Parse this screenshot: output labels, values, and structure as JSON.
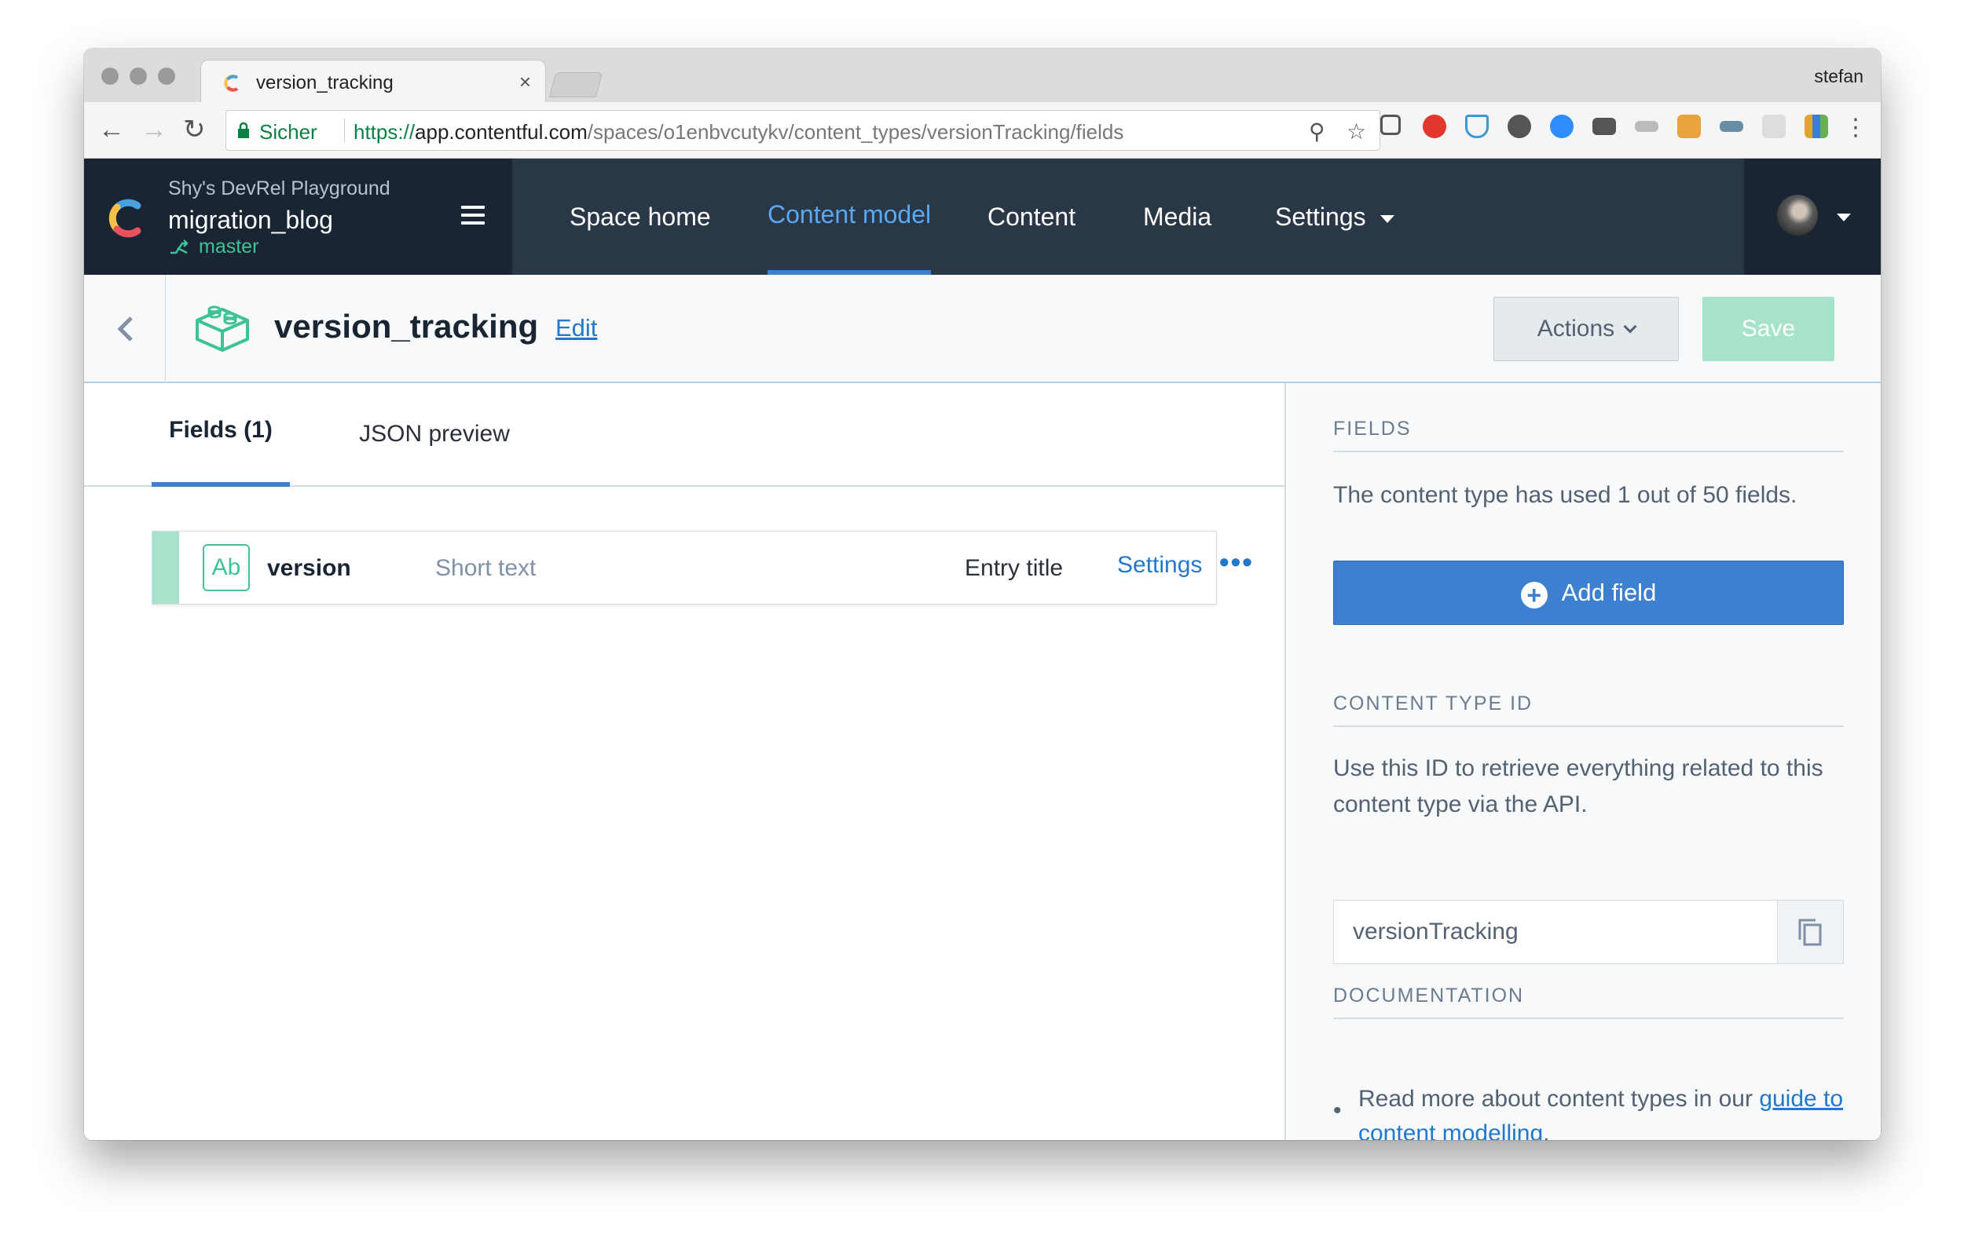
{
  "browser": {
    "tab_title": "version_tracking",
    "tab_close": "×",
    "profile_name": "stefan",
    "secure_label": "Sicher",
    "url_protocol": "https://",
    "url_host": "app.contentful.com",
    "url_path": "/spaces/o1enbvcutykv/content_types/versionTracking/fields",
    "nav_back": "←",
    "nav_forward": "→",
    "nav_reload": "↻",
    "zoom_icon": "⚲",
    "star_icon": "☆",
    "menu_icon": "⋮"
  },
  "appnav": {
    "space_subtitle": "Shy's DevRel Playground",
    "space_name": "migration_blog",
    "environment": "master",
    "items": [
      {
        "label": "Space home"
      },
      {
        "label": "Content model"
      },
      {
        "label": "Content"
      },
      {
        "label": "Media"
      },
      {
        "label": "Settings"
      }
    ]
  },
  "header": {
    "title": "version_tracking",
    "edit_label": "Edit",
    "actions_label": "Actions",
    "save_label": "Save"
  },
  "main": {
    "tabs": [
      {
        "label": "Fields (1)"
      },
      {
        "label": "JSON preview"
      }
    ],
    "fields": [
      {
        "type_icon": "Ab",
        "name": "version",
        "type": "Short text",
        "badge": "Entry title",
        "settings_label": "Settings",
        "more": "•••"
      }
    ]
  },
  "sidebar": {
    "fields_heading": "FIELDS",
    "fields_text": "The content type has used 1 out of 50 fields.",
    "add_field_label": "Add field",
    "ct_id_heading": "CONTENT TYPE ID",
    "ct_id_text": "Use this ID to retrieve everything related to this content type via the API.",
    "ct_id_value": "versionTracking",
    "doc_heading": "DOCUMENTATION",
    "doc_text_prefix": "Read more about content types in our ",
    "doc_link": "guide to content modelling",
    "doc_text_suffix": "."
  },
  "colors": {
    "nav_bg": "#2a3747",
    "nav_dark": "#192532",
    "accent_blue": "#3c80cf",
    "accent_green": "#3fc295",
    "save_disabled": "#a6e3ca"
  }
}
